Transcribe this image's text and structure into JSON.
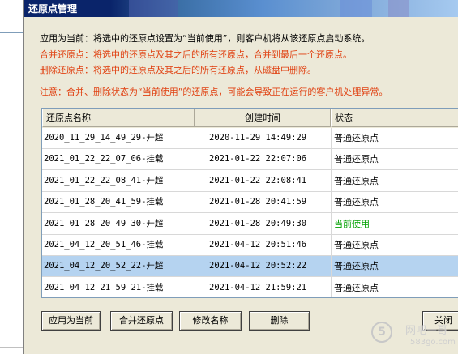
{
  "dialog": {
    "title": "还原点管理"
  },
  "notes": {
    "line1": "应用为当前：将选中的还原点设置为“当前使用”，则客户机将从该还原点启动系统。",
    "line2": "合并还原点：将选中的还原点及其之后的所有还原点，合并到最后一个还原点。",
    "line3": "删除还原点：将选中的还原点及其之后的所有还原点，从磁盘中删除。",
    "line4": "注意：合并、删除状态为“当前使用”的还原点，可能会导致正在运行的客户机处理异常。"
  },
  "table": {
    "columns": [
      "还原点名称",
      "创建时间",
      "状态"
    ],
    "rows": [
      {
        "name": "2020_11_29_14_49_29-开超",
        "time": "2020-11-29 14:49:29",
        "status": "普通还原点"
      },
      {
        "name": "2021_01_22_22_07_06-挂载",
        "time": "2021-01-22 22:07:06",
        "status": "普通还原点"
      },
      {
        "name": "2021_01_22_22_08_41-开超",
        "time": "2021-01-22 22:08:41",
        "status": "普通还原点"
      },
      {
        "name": "2021_01_28_20_41_59-挂载",
        "time": "2021-01-28 20:41:59",
        "status": "普通还原点"
      },
      {
        "name": "2021_01_28_20_49_30-开超",
        "time": "2021-01-28 20:49:30",
        "status": "当前使用"
      },
      {
        "name": "2021_04_12_20_51_46-挂载",
        "time": "2021-04-12 20:51:46",
        "status": "普通还原点"
      },
      {
        "name": "2021_04_12_20_52_22-开超",
        "time": "2021-04-12 20:52:22",
        "status": "普通还原点"
      },
      {
        "name": "2021_04_12_21_59_21-挂载",
        "time": "2021-04-12 21:59:21",
        "status": "普通还原点"
      }
    ],
    "selected_row": 6
  },
  "buttons": {
    "apply": "应用为当前",
    "merge": "合并还原点",
    "rename": "修改名称",
    "delete": "删除",
    "close": "关闭"
  },
  "watermark": {
    "logo": "5",
    "text": "网吧一哥",
    "url": "583go.com"
  },
  "colors": {
    "red_text": "#e04010",
    "current_status": "#00a000",
    "selected_row": "#b5d3f0",
    "dialog_bg": "#ece9d8"
  }
}
